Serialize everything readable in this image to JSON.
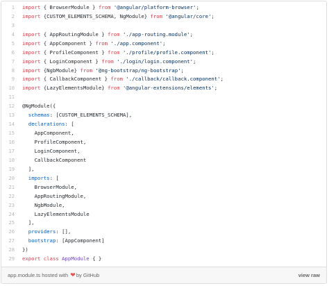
{
  "code": {
    "lines": [
      {
        "n": "1",
        "tokens": [
          [
            "k",
            "import"
          ],
          [
            "p",
            " { BrowserModule } "
          ],
          [
            "k",
            "from"
          ],
          [
            "p",
            " "
          ],
          [
            "s",
            "'@angular/platform-browser'"
          ],
          [
            "p",
            ";"
          ]
        ]
      },
      {
        "n": "2",
        "tokens": [
          [
            "k",
            "import"
          ],
          [
            "p",
            " {CUSTOM_ELEMENTS_SCHEMA, NgModule} "
          ],
          [
            "k",
            "from"
          ],
          [
            "p",
            " "
          ],
          [
            "s",
            "'@angular/core'"
          ],
          [
            "p",
            ";"
          ]
        ]
      },
      {
        "n": "3",
        "tokens": []
      },
      {
        "n": "4",
        "tokens": [
          [
            "k",
            "import"
          ],
          [
            "p",
            " { AppRoutingModule } "
          ],
          [
            "k",
            "from"
          ],
          [
            "p",
            " "
          ],
          [
            "s",
            "'./app-routing.module'"
          ],
          [
            "p",
            ";"
          ]
        ]
      },
      {
        "n": "5",
        "tokens": [
          [
            "k",
            "import"
          ],
          [
            "p",
            " { AppComponent } "
          ],
          [
            "k",
            "from"
          ],
          [
            "p",
            " "
          ],
          [
            "s",
            "'./app.component'"
          ],
          [
            "p",
            ";"
          ]
        ]
      },
      {
        "n": "6",
        "tokens": [
          [
            "k",
            "import"
          ],
          [
            "p",
            " { ProfileComponent } "
          ],
          [
            "k",
            "from"
          ],
          [
            "p",
            " "
          ],
          [
            "s",
            "'./profile/profile.component'"
          ],
          [
            "p",
            ";"
          ]
        ]
      },
      {
        "n": "7",
        "tokens": [
          [
            "k",
            "import"
          ],
          [
            "p",
            " { LoginComponent } "
          ],
          [
            "k",
            "from"
          ],
          [
            "p",
            " "
          ],
          [
            "s",
            "'./login/login.component'"
          ],
          [
            "p",
            ";"
          ]
        ]
      },
      {
        "n": "8",
        "tokens": [
          [
            "k",
            "import"
          ],
          [
            "p",
            " {NgbModule} "
          ],
          [
            "k",
            "from"
          ],
          [
            "p",
            " "
          ],
          [
            "s",
            "'@ng-bootstrap/ng-bootstrap'"
          ],
          [
            "p",
            ";"
          ]
        ]
      },
      {
        "n": "9",
        "tokens": [
          [
            "k",
            "import"
          ],
          [
            "p",
            " { CallbackComponent } "
          ],
          [
            "k",
            "from"
          ],
          [
            "p",
            " "
          ],
          [
            "s",
            "'./callback/callback.component'"
          ],
          [
            "p",
            ";"
          ]
        ]
      },
      {
        "n": "10",
        "tokens": [
          [
            "k",
            "import"
          ],
          [
            "p",
            " {LazyElementsModule} "
          ],
          [
            "k",
            "from"
          ],
          [
            "p",
            " "
          ],
          [
            "s",
            "'@angular-extensions/elements'"
          ],
          [
            "p",
            ";"
          ]
        ]
      },
      {
        "n": "11",
        "tokens": []
      },
      {
        "n": "12",
        "tokens": [
          [
            "p",
            "@NgModule({"
          ]
        ]
      },
      {
        "n": "13",
        "tokens": [
          [
            "p",
            "  "
          ],
          [
            "c",
            "schemas"
          ],
          [
            "p",
            ": [CUSTOM_ELEMENTS_SCHEMA],"
          ]
        ]
      },
      {
        "n": "14",
        "tokens": [
          [
            "p",
            "  "
          ],
          [
            "c",
            "declarations"
          ],
          [
            "p",
            ": ["
          ]
        ]
      },
      {
        "n": "15",
        "tokens": [
          [
            "p",
            "    AppComponent,"
          ]
        ]
      },
      {
        "n": "16",
        "tokens": [
          [
            "p",
            "    ProfileComponent,"
          ]
        ]
      },
      {
        "n": "17",
        "tokens": [
          [
            "p",
            "    LoginComponent,"
          ]
        ]
      },
      {
        "n": "18",
        "tokens": [
          [
            "p",
            "    CallbackComponent"
          ]
        ]
      },
      {
        "n": "19",
        "tokens": [
          [
            "p",
            "  ],"
          ]
        ]
      },
      {
        "n": "20",
        "tokens": [
          [
            "p",
            "  "
          ],
          [
            "c",
            "imports"
          ],
          [
            "p",
            ": ["
          ]
        ]
      },
      {
        "n": "21",
        "tokens": [
          [
            "p",
            "    BrowserModule,"
          ]
        ]
      },
      {
        "n": "22",
        "tokens": [
          [
            "p",
            "    AppRoutingModule,"
          ]
        ]
      },
      {
        "n": "23",
        "tokens": [
          [
            "p",
            "    NgbModule,"
          ]
        ]
      },
      {
        "n": "24",
        "tokens": [
          [
            "p",
            "    LazyElementsModule"
          ]
        ]
      },
      {
        "n": "25",
        "tokens": [
          [
            "p",
            "  ],"
          ]
        ]
      },
      {
        "n": "26",
        "tokens": [
          [
            "p",
            "  "
          ],
          [
            "c",
            "providers"
          ],
          [
            "p",
            ": [],"
          ]
        ]
      },
      {
        "n": "27",
        "tokens": [
          [
            "p",
            "  "
          ],
          [
            "c",
            "bootstrap"
          ],
          [
            "p",
            ": [AppComponent]"
          ]
        ]
      },
      {
        "n": "28",
        "tokens": [
          [
            "p",
            "})"
          ]
        ]
      },
      {
        "n": "29",
        "tokens": [
          [
            "k",
            "export"
          ],
          [
            "p",
            " "
          ],
          [
            "k",
            "class"
          ],
          [
            "p",
            " "
          ],
          [
            "e",
            "AppModule"
          ],
          [
            "p",
            " { }"
          ]
        ]
      }
    ]
  },
  "footer": {
    "file_name": "app.module.ts",
    "hosted_with": "hosted with",
    "heart": "❤",
    "by": "by",
    "github": "GitHub",
    "view_raw": "view raw"
  },
  "colors": {
    "keyword": "#d73a49",
    "string": "#032f62",
    "entity": "#6f42c1",
    "constant": "#005cc5",
    "heart": "#e25555"
  }
}
